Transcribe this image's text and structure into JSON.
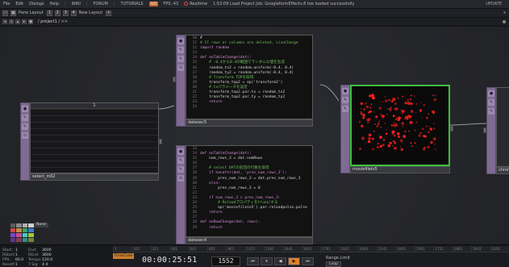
{
  "menu": {
    "items": [
      "File",
      "Edit",
      "Dialogs",
      "Help"
    ],
    "win_label": "WIKI",
    "forum_label": "FORUM",
    "tutorials_label": "TUTORIALS",
    "badge": "GO",
    "fps_label": "FPS: 43",
    "realtime_label": "Realtime",
    "status_message": "1:52:09 Load Project Job: GoogleformEffects.8 toe loaded successfully",
    "update_label": "UPDATE"
  },
  "toolbar": {
    "pane_layout": "Pane Layout",
    "new_layout": "New Layout",
    "add": "+",
    "close": "x"
  },
  "pathbar": {
    "path": "/ project1 / >>"
  },
  "nodes": {
    "select": {
      "label": "select_m02",
      "header": "1"
    },
    "datexec5": {
      "label": "datexec5",
      "lines": [
        {
          "n": "10",
          "t": "#",
          "c": ""
        },
        {
          "n": "11",
          "t": "# If rows or columns are deleted, sizeChange",
          "c": "cm"
        },
        {
          "n": "12",
          "t": "import random",
          "c": "kw"
        },
        {
          "n": "13",
          "t": "",
          "c": ""
        },
        {
          "n": "14",
          "t": "def onTableChange(dat):",
          "c": "kw"
        },
        {
          "n": "15",
          "t": "    # -0.4から0.4の範囲でランダムな値を生成",
          "c": "cm"
        },
        {
          "n": "16",
          "t": "    random_tx2 = random.uniform(-0.4, 0.4)",
          "c": ""
        },
        {
          "n": "17",
          "t": "    random_ty2 = random.uniform(-0.4, 0.4)",
          "c": ""
        },
        {
          "n": "18",
          "t": "    # Transform TOPを取得",
          "c": "cm"
        },
        {
          "n": "19",
          "t": "    transform_top2 = op('transform2')",
          "c": ""
        },
        {
          "n": "20",
          "t": "    # txパラメータを設定",
          "c": "cm"
        },
        {
          "n": "21",
          "t": "    transform_top2.par.tx = random_tx2",
          "c": ""
        },
        {
          "n": "22",
          "t": "    transform_top2.par.ty = random_ty2",
          "c": ""
        },
        {
          "n": "23",
          "t": "    return",
          "c": "kw"
        },
        {
          "n": "24",
          "t": "",
          "c": ""
        }
      ]
    },
    "datexec4": {
      "label": "datexec4",
      "lines": [
        {
          "n": "13",
          "t": "",
          "c": ""
        },
        {
          "n": "14",
          "t": "def onTableChange(dat):",
          "c": "kw"
        },
        {
          "n": "15",
          "t": "    num_rows_3 = dat.numRows",
          "c": ""
        },
        {
          "n": "16",
          "t": "",
          "c": ""
        },
        {
          "n": "17",
          "t": "    # select DATの前回の行数を取得",
          "c": "cm"
        },
        {
          "n": "18",
          "t": "    if hasattr(dat, 'prev_num_rows_3'):",
          "c": "kw"
        },
        {
          "n": "19",
          "t": "        prev_num_rows_3 = dat.prev_num_rows_3",
          "c": ""
        },
        {
          "n": "20",
          "t": "    else:",
          "c": "kw"
        },
        {
          "n": "21",
          "t": "        prev_num_rows_3 = 0",
          "c": ""
        },
        {
          "n": "22",
          "t": "",
          "c": ""
        },
        {
          "n": "23",
          "t": "    if num_rows_3 > prev_num_rows_3:",
          "c": "kw"
        },
        {
          "n": "24",
          "t": "        # Reloadプロパティをtrueにする",
          "c": "cm"
        },
        {
          "n": "25",
          "t": "        op('moviefilein5').par.reloadpulse.pulse",
          "c": ""
        },
        {
          "n": "26",
          "t": "    return",
          "c": "kw"
        },
        {
          "n": "27",
          "t": "",
          "c": ""
        },
        {
          "n": "28",
          "t": "def onRowChange(dat, rows):",
          "c": "kw"
        },
        {
          "n": "29",
          "t": "    return",
          "c": "kw"
        }
      ]
    },
    "movie": {
      "label": "moviefilein5"
    },
    "chroma": {
      "label": "chroma3"
    }
  },
  "palette": {
    "none_label": "None",
    "colors": [
      [
        "#5b5b5b",
        "#8a8a8a",
        "#b0b0b0",
        "#d0d0d0"
      ],
      [
        "#c94a4a",
        "#c98a3a",
        "#3aa35a",
        "#3a7ac9"
      ],
      [
        "#7a4ac9",
        "#c94a9a",
        "#4ac9c9",
        "#a3c93a"
      ],
      [
        "#5a3a8a",
        "#8a3a5a",
        "#3a8a8a",
        "#6a8a3a"
      ]
    ]
  },
  "stats": {
    "rows": [
      {
        "k": "Start:",
        "v": "1",
        "k2": "End:",
        "v2": "3600"
      },
      {
        "k": "RStart:",
        "v": "1",
        "k2": "REnd:",
        "v2": "3600"
      },
      {
        "k": "FPS:",
        "v": "60.0",
        "k2": "Tempo:",
        "v2": "120.0"
      },
      {
        "k": "Resetf:",
        "v": "1",
        "k2": "T Sig:",
        "v2": "4 4"
      }
    ]
  },
  "timeline": {
    "ticks": [
      "1",
      "161",
      "321",
      "481",
      "641",
      "801",
      "961",
      "1121",
      "1281",
      "1441",
      "1601",
      "1761",
      "1921",
      "2081",
      "2241",
      "2401",
      "2561",
      "2721",
      "2881",
      "3041",
      "3201"
    ],
    "timecode_label": "TimeCode",
    "timecode": "00:00:25:51",
    "frame": "1552",
    "transport": [
      "⏮",
      "⏸",
      "◀",
      "▶",
      "⏭"
    ],
    "range_limit_label": "Range Limit",
    "range_button": "Loop"
  },
  "colors": {
    "accent_orange": "#d9812c",
    "node_purple": "#7e6a93",
    "movie_green": "#3fbf3f",
    "particle_red": "#ff2020"
  }
}
